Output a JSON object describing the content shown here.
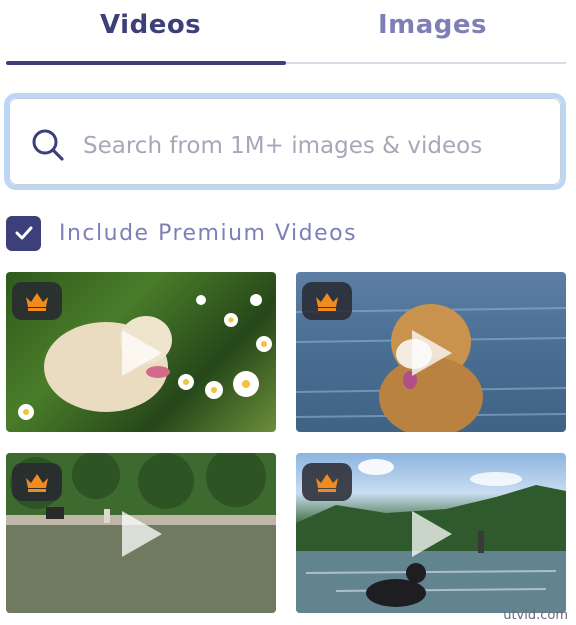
{
  "tabs": [
    {
      "label": "Videos",
      "active": true
    },
    {
      "label": "Images",
      "active": false
    }
  ],
  "search": {
    "placeholder": "Search from 1M+ images & videos",
    "value": ""
  },
  "premium": {
    "label": "Include Premium Videos",
    "checked": true
  },
  "results": [
    {
      "type": "video",
      "premium": true,
      "subject": "dog in daisies"
    },
    {
      "type": "video",
      "premium": true,
      "subject": "dog swimming in lake"
    },
    {
      "type": "video",
      "premium": true,
      "subject": "people wading in river"
    },
    {
      "type": "video",
      "premium": true,
      "subject": "dog in lake with mountains"
    }
  ],
  "watermark": "utvid.com",
  "colors": {
    "primary": "#3c3f7a",
    "secondary": "#7f7fb8",
    "search_focus": "#bcd7f6",
    "crown": "#f08c1e"
  }
}
